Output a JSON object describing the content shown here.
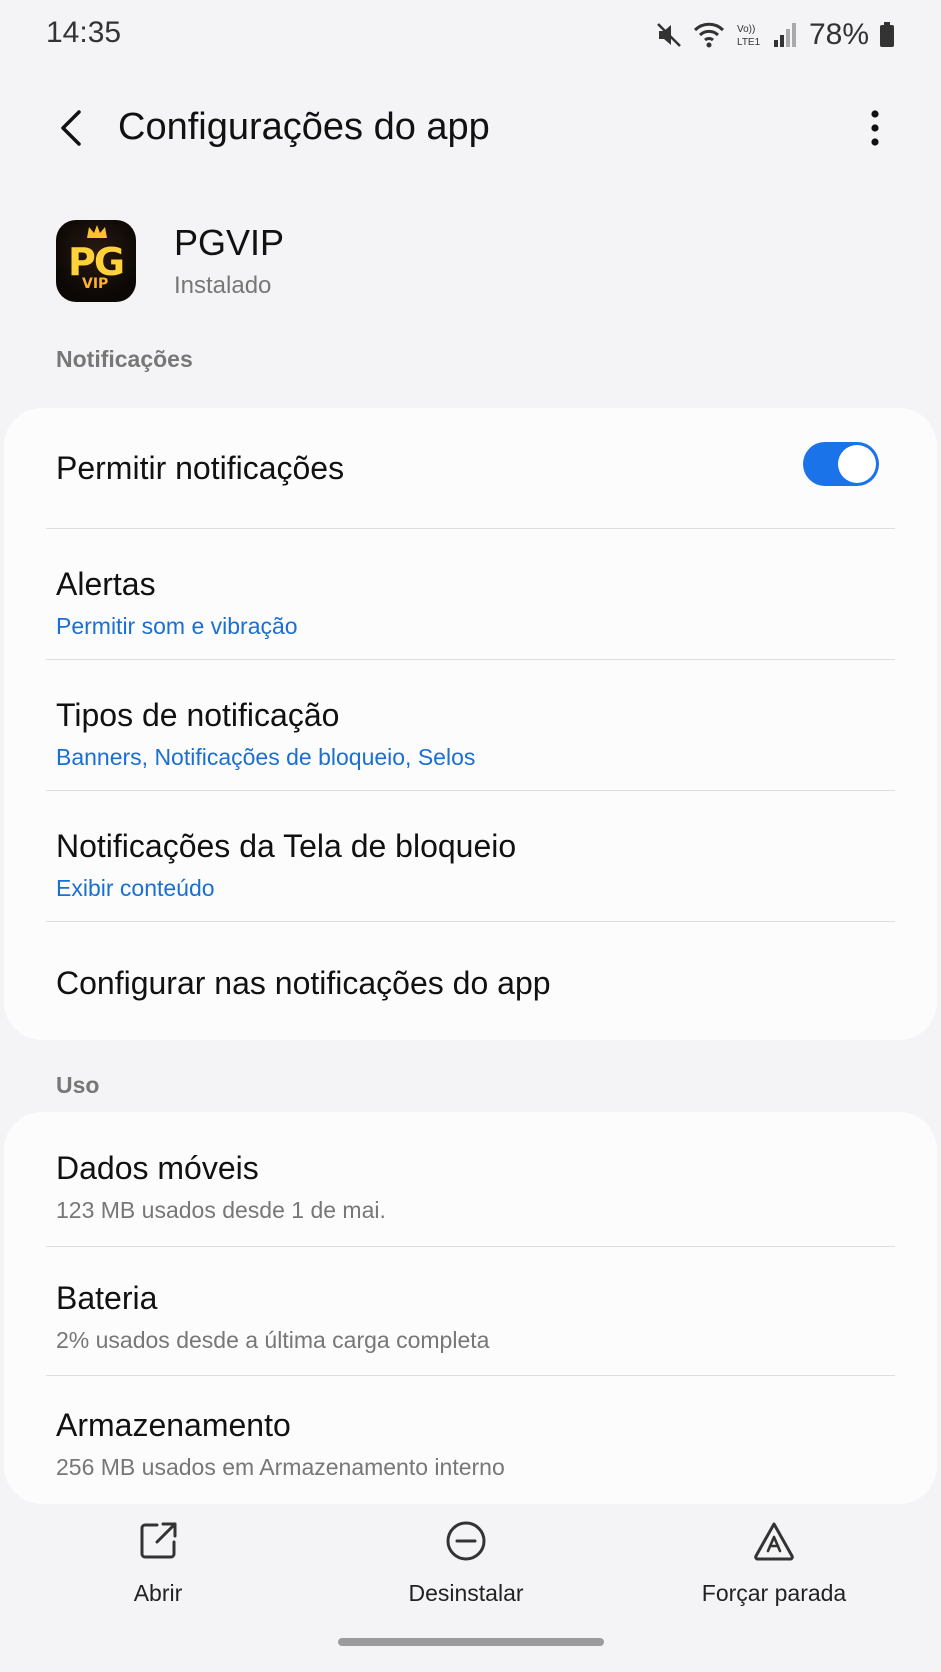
{
  "status_bar": {
    "time": "14:35",
    "battery": "78%",
    "icons": [
      "mute-icon",
      "wifi-icon",
      "volte-icon",
      "signal-icon",
      "battery-icon"
    ]
  },
  "app_bar": {
    "title": "Configurações do app"
  },
  "app": {
    "name": "PGVIP",
    "status": "Instalado",
    "icon_text": "PG",
    "icon_sub": "VIP"
  },
  "notifications": {
    "section_label": "Notificações",
    "allow": {
      "title": "Permitir notificações",
      "enabled": true
    },
    "alerts": {
      "title": "Alertas",
      "subtitle": "Permitir som e vibração"
    },
    "types": {
      "title": "Tipos de notificação",
      "subtitle": "Banners, Notificações de bloqueio, Selos"
    },
    "lockscreen": {
      "title": "Notificações da Tela de bloqueio",
      "subtitle": "Exibir conteúdo"
    },
    "configure": {
      "title": "Configurar nas notificações do app"
    }
  },
  "usage": {
    "section_label": "Uso",
    "mobile_data": {
      "title": "Dados móveis",
      "subtitle": "123 MB usados desde 1 de mai."
    },
    "battery": {
      "title": "Bateria",
      "subtitle": "2% usados desde a última carga completa"
    },
    "storage": {
      "title": "Armazenamento",
      "subtitle": "256 MB usados em Armazenamento interno"
    }
  },
  "actions": {
    "open": "Abrir",
    "uninstall": "Desinstalar",
    "force_stop": "Forçar parada"
  },
  "colors": {
    "accent": "#1a73e8",
    "link": "#1a6fd1",
    "background": "#f4f4f6",
    "card": "#fcfcfd"
  }
}
